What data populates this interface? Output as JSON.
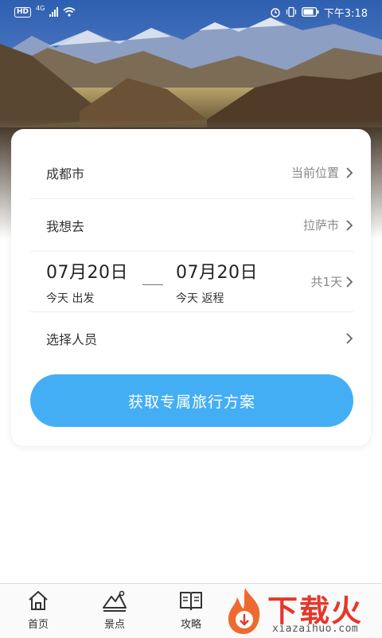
{
  "status_bar": {
    "hd": "HD",
    "network": "4G",
    "time": "下午3:18"
  },
  "trip": {
    "origin": {
      "city": "成都市",
      "action": "当前位置"
    },
    "destination": {
      "label": "我想去",
      "city": "拉萨市"
    },
    "depart": {
      "date": "07月20日",
      "sub": "今天 出发"
    },
    "return": {
      "date": "07月20日",
      "sub": "今天 返程"
    },
    "duration": "共1天",
    "people": {
      "label": "选择人员"
    },
    "cta": "获取专属旅行方案"
  },
  "bottom_nav": {
    "items": [
      {
        "label": "首页",
        "icon": "home-icon"
      },
      {
        "label": "景点",
        "icon": "mountain-icon"
      },
      {
        "label": "攻略",
        "icon": "book-icon"
      }
    ]
  },
  "watermark": {
    "brand": "下载火",
    "url": "xiazaihuo.com"
  },
  "colors": {
    "accent": "#44aef5",
    "watermark": "#e5372a"
  }
}
